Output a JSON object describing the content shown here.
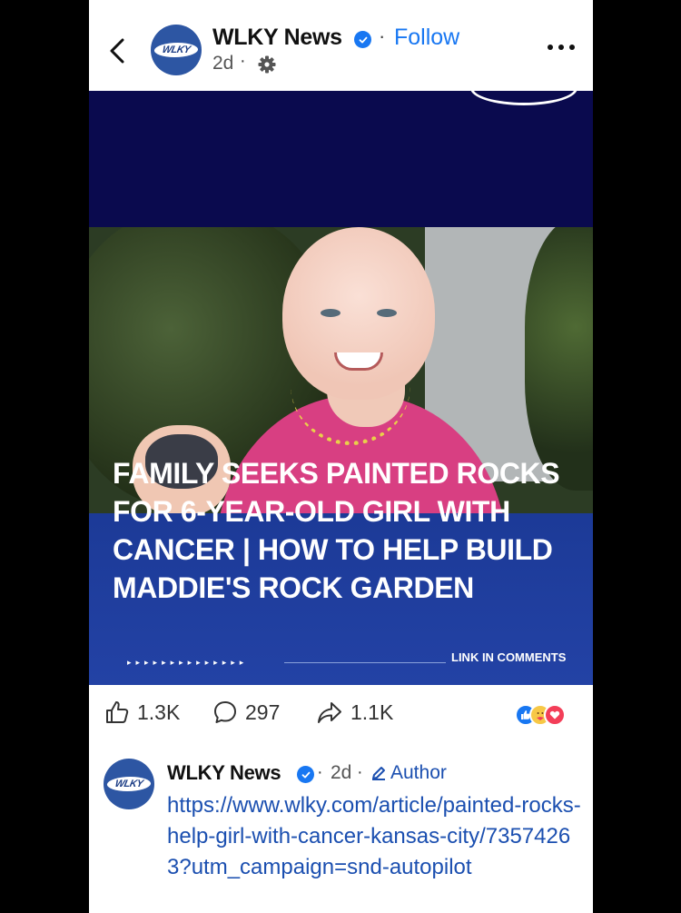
{
  "post": {
    "page_name": "WLKY News",
    "follow_label": "Follow",
    "time": "2d",
    "separator": "·",
    "avatar_text": "WLKY"
  },
  "media": {
    "headline": "FAMILY SEEKS PAINTED ROCKS FOR 6-YEAR-OLD GIRL WITH CANCER | HOW TO HELP BUILD MADDIE'S ROCK GARDEN",
    "arrows": "▸▸▸▸▸▸▸▸▸▸▸▸▸▸",
    "link_in_comments": "LINK IN COMMENTS"
  },
  "actions": {
    "likes": "1.3K",
    "comments": "297",
    "shares": "1.1K"
  },
  "comment": {
    "name": "WLKY News",
    "time": "2d",
    "separator": "·",
    "author_label": "Author",
    "text": "https://www.wlky.com/article/painted-rocks-help-girl-with-cancer-kansas-city/73574263?utm_campaign=snd-autopilot",
    "avatar_text": "WLKY"
  },
  "colors": {
    "accent": "#1877f2",
    "link": "#1b4fb0",
    "headline_panel": "#2342a5",
    "top_band": "#0a0a4e"
  },
  "icons": [
    "back-arrow-icon",
    "verified-badge-icon",
    "gear-icon",
    "more-options-icon",
    "like-icon",
    "comment-icon",
    "share-icon",
    "like-reaction-icon",
    "care-reaction-icon",
    "love-reaction-icon",
    "pencil-icon"
  ]
}
